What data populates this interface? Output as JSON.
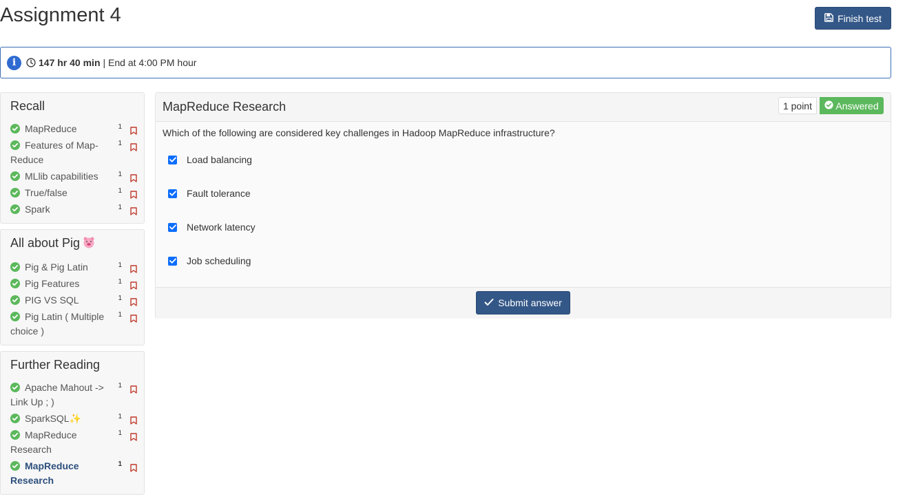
{
  "page": {
    "title": "Assignment 4"
  },
  "header": {
    "finish_label": "Finish test"
  },
  "timer": {
    "remaining": "147 hr 40 min",
    "separator": "|",
    "end_text": "End at 4:00 PM hour"
  },
  "sidebar": {
    "sections": [
      {
        "title": "Recall",
        "items": [
          {
            "label": "MapReduce",
            "points": "1"
          },
          {
            "label": "Features of Map-Reduce",
            "points": "1"
          },
          {
            "label": "MLlib capabilities",
            "points": "1"
          },
          {
            "label": "True/false",
            "points": "1"
          },
          {
            "label": "Spark",
            "points": "1"
          }
        ]
      },
      {
        "title": "All about Pig",
        "items": [
          {
            "label": "Pig & Pig Latin",
            "points": "1"
          },
          {
            "label": "Pig Features",
            "points": "1"
          },
          {
            "label": "PIG VS SQL",
            "points": "1"
          },
          {
            "label": "Pig Latin ( Multiple choice )",
            "points": "1"
          }
        ]
      },
      {
        "title": "Further Reading",
        "items": [
          {
            "label": "Apache Mahout -> Link Up ; )",
            "points": "1"
          },
          {
            "label": "SparkSQL✨",
            "points": "1"
          },
          {
            "label": "MapReduce Research",
            "points": "1"
          },
          {
            "label": "MapReduce Research",
            "points": "1"
          }
        ]
      }
    ]
  },
  "question": {
    "title": "MapReduce Research",
    "points_label": "1 point",
    "status_label": "Answered",
    "text": "Which of the following are considered key challenges in Hadoop MapReduce infrastructure?",
    "options": [
      {
        "label": "Load balancing",
        "checked": true
      },
      {
        "label": "Fault tolerance",
        "checked": true
      },
      {
        "label": "Network latency",
        "checked": true
      },
      {
        "label": "Job scheduling",
        "checked": true
      }
    ],
    "submit_label": "Submit answer"
  },
  "colors": {
    "primary": "#335787",
    "success": "#5cb85c",
    "info_border": "#3b6fb6",
    "bookmark": "#c0392b"
  }
}
